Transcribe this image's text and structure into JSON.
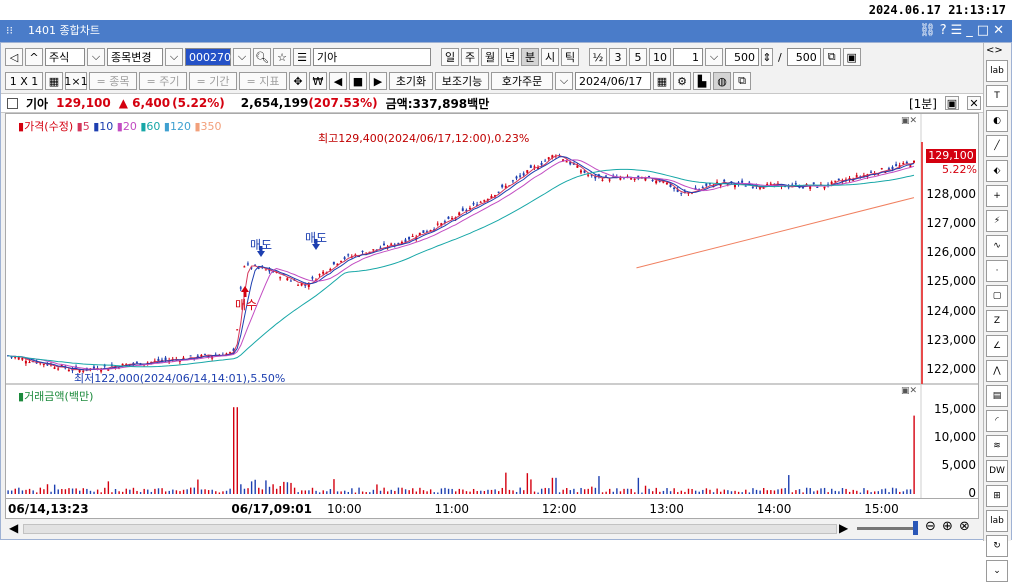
{
  "clock": "2024.06.17 21:13:17",
  "window": {
    "title": "1401 종합차트",
    "controls": [
      "link-icon",
      "help-icon",
      "menu-icon",
      "minimize-icon",
      "maximize-icon",
      "close-icon"
    ]
  },
  "toolbar1": {
    "prev_label": "◁",
    "up_label": "^",
    "asset_type": "주식",
    "change_label": "종목변경",
    "stock_code": "000270",
    "stock_name": "기아",
    "periods": [
      "일",
      "주",
      "월",
      "년",
      "분",
      "시",
      "틱"
    ],
    "active_period": "분",
    "half": "½",
    "intervals": [
      "3",
      "5",
      "10"
    ],
    "interval_value": "1",
    "count_value": "500",
    "slash": "/",
    "count_total": "500"
  },
  "toolbar2": {
    "layout_label": "1 X 1",
    "one_label": "1×1",
    "compare": [
      "= 종목",
      "= 주기",
      "= 기간",
      "= 지표"
    ],
    "reset_label": "초기화",
    "assist_label": "보조기능",
    "order_label": "호가주문",
    "date_value": "2024/06/17"
  },
  "info": {
    "name": "기아",
    "price": "129,100",
    "change": "▲ 6,400",
    "change_pct": "(5.22%)",
    "volume": "2,654,199",
    "volume_pct": "(207.53%)",
    "amount": "금액:337,898백만",
    "interval_badge": "[1분]"
  },
  "price_pane": {
    "legend_title": "가격(수정)",
    "ma_legend": [
      {
        "label": "5",
        "color": "#d4365b"
      },
      {
        "label": "10",
        "color": "#1d3fb0"
      },
      {
        "label": "20",
        "color": "#c24cc2"
      },
      {
        "label": "60",
        "color": "#17a7a7"
      },
      {
        "label": "120",
        "color": "#3fa0d0"
      },
      {
        "label": "350",
        "color": "#f2a07b"
      }
    ],
    "high_annot": "최고129,400(2024/06/17,12:00),0.23%",
    "low_annot": "최저122,000(2024/06/14,14:01),5.50%",
    "sell_label_1": "매도",
    "sell_label_2": "매도",
    "buy_label": "매수",
    "price_badge": "129,100",
    "pct_badge": "5.22%",
    "y_ticks": [
      "128,000",
      "127,000",
      "126,000",
      "125,000",
      "124,000",
      "123,000",
      "122,000"
    ]
  },
  "volume_pane": {
    "legend_title": "거래금액(백만)",
    "y_ticks": [
      "15,000",
      "10,000",
      "5,000",
      "0"
    ]
  },
  "time_axis": [
    "06/14,13:23",
    "06/17,09:01",
    "10:00",
    "11:00",
    "12:00",
    "13:00",
    "14:00",
    "15:00"
  ],
  "chart_data": {
    "type": "line",
    "title": "",
    "price_ylim": [
      121600,
      129800
    ],
    "volume_ylim": [
      0,
      17500
    ],
    "x_ticks": [
      "06/14,13:23",
      "06/17,09:01",
      "10:00",
      "11:00",
      "12:00",
      "13:00",
      "14:00",
      "15:00"
    ],
    "series": [
      {
        "name": "가격(수정)",
        "x": [
          "06/14,13:23",
          "06/14,14:01",
          "06/14,15:30",
          "06/17,09:01",
          "06/17,09:05",
          "06/17,09:20",
          "06/17,09:40",
          "06/17,10:00",
          "06/17,10:30",
          "06/17,11:00",
          "06/17,11:30",
          "06/17,12:00",
          "06/17,12:20",
          "06/17,13:00",
          "06/17,13:10",
          "06/17,13:30",
          "06/17,14:00",
          "06/17,14:30",
          "06/17,15:00",
          "06/17,15:20"
        ],
        "values": [
          122500,
          122000,
          122600,
          122600,
          125600,
          125400,
          124900,
          125800,
          126300,
          127100,
          128200,
          129400,
          128600,
          128500,
          128000,
          128400,
          128300,
          128300,
          128800,
          129100
        ]
      },
      {
        "name": "350",
        "x": [
          "06/17,12:45",
          "06/17,15:20"
        ],
        "values": [
          125500,
          127900
        ]
      }
    ],
    "high": {
      "value": 129400,
      "time": "2024/06/17,12:00",
      "pct": "0.23%"
    },
    "low": {
      "value": 122000,
      "time": "2024/06/14,14:01",
      "pct": "5.50%"
    },
    "volume_peaks": [
      {
        "x": "06/17,09:01",
        "value": 15500
      },
      {
        "x": "06/17,15:20",
        "value": 14000
      }
    ]
  },
  "zoom_controls": [
    "zoom-out-icon",
    "zoom-reset-icon",
    "zoom-in-icon"
  ],
  "tools": [
    "lab",
    "T",
    "pie",
    "line",
    "ruler",
    "plus",
    "bolt",
    "wave",
    "dot",
    "rect",
    "Z",
    "ang",
    "fan",
    "grid",
    "arc",
    "wave2",
    "DW",
    "tl",
    "lab2",
    "ref",
    "down"
  ]
}
